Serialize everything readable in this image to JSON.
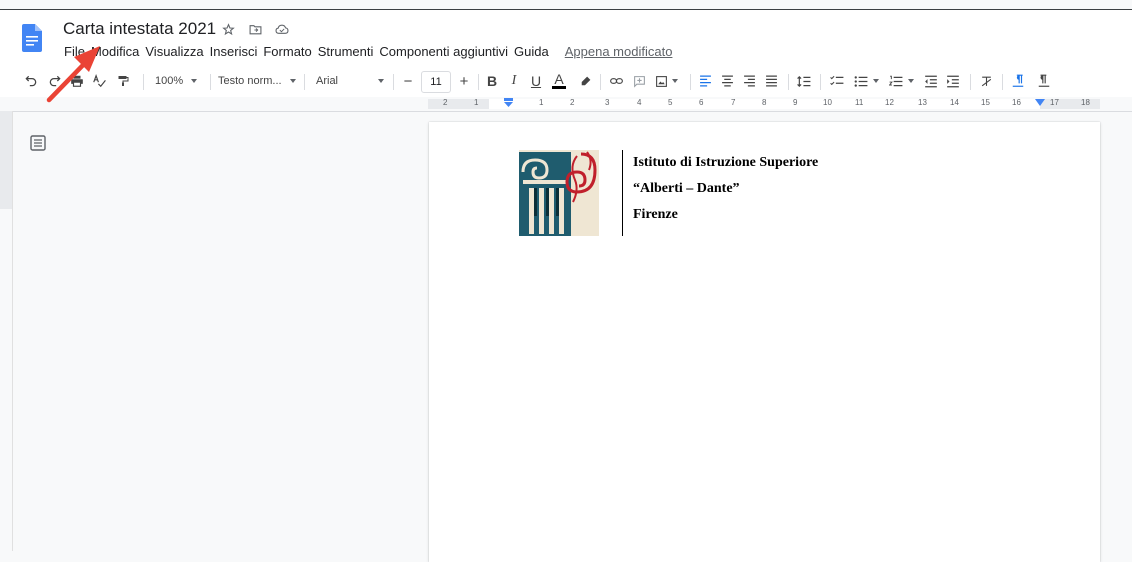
{
  "document": {
    "title": "Carta intestata 2021"
  },
  "menu": [
    "File",
    "Modifica",
    "Visualizza",
    "Inserisci",
    "Formato",
    "Strumenti",
    "Componenti aggiuntivi",
    "Guida"
  ],
  "last_edit": "Appena modificato",
  "toolbar": {
    "zoom": "100%",
    "style": "Testo norm...",
    "font": "Arial",
    "font_size": "11",
    "minus": "−",
    "plus": "+",
    "bold": "B",
    "italic": "I",
    "underline": "U",
    "text_color": "A"
  },
  "ruler": [
    "2",
    "1",
    "1",
    "2",
    "3",
    "4",
    "5",
    "6",
    "7",
    "8",
    "9",
    "10",
    "11",
    "12",
    "13",
    "14",
    "15",
    "16",
    "17",
    "18"
  ],
  "letterhead": {
    "line1": "Istituto di Istruzione Superiore",
    "line2": "“Alberti – Dante”",
    "line3": "Firenze"
  },
  "colors": {
    "accent": "#4285f4",
    "arrow": "#ea4335",
    "logo_teal": "#1f5c6e",
    "logo_red": "#c0202c",
    "logo_bg": "#efe6d3"
  }
}
